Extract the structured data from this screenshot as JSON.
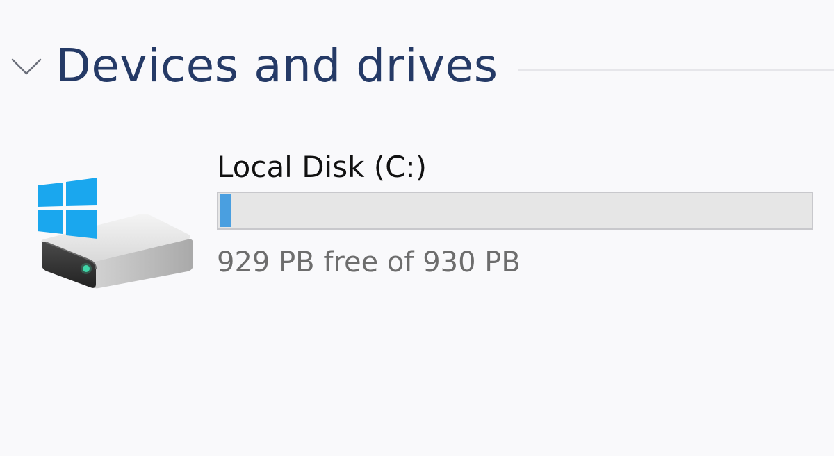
{
  "section": {
    "title": "Devices and drives",
    "expanded": true,
    "chevron_icon": "chevron-down-icon"
  },
  "drives": [
    {
      "name": "Local Disk (C:)",
      "space_text": "929 PB free of 930 PB",
      "used_fraction": 0.011,
      "icon": "windows-hard-drive-icon"
    }
  ],
  "colors": {
    "background": "#f9f9fb",
    "title": "#253a66",
    "usage_fill": "#4a9fe0",
    "usage_track": "#e6e6e6",
    "windows_logo": "#1aa7ee"
  }
}
